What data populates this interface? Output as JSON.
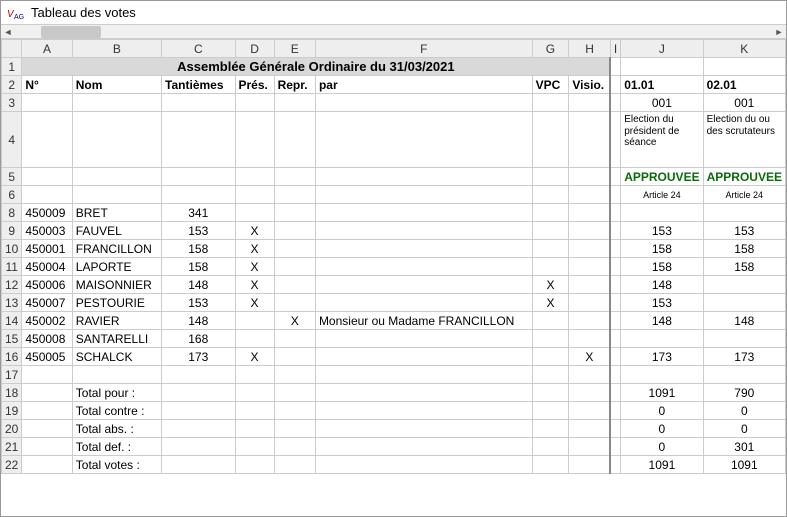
{
  "window": {
    "title": "Tableau des votes"
  },
  "columns": [
    "A",
    "B",
    "C",
    "D",
    "E",
    "F",
    "G",
    "H",
    "I",
    "J",
    "K"
  ],
  "rows_header": [
    "1",
    "2",
    "3",
    "4",
    "5",
    "6",
    "8",
    "9",
    "10",
    "11",
    "12",
    "13",
    "14",
    "15",
    "16",
    "17",
    "18",
    "19",
    "20",
    "21",
    "22"
  ],
  "title_row": "Assemblée Générale Ordinaire du 31/03/2021",
  "headers": {
    "A": "N°",
    "B": "Nom",
    "C": "Tantièmes",
    "D": "Prés.",
    "E": "Repr.",
    "F": "par",
    "G": "VPC",
    "H": "Visio.",
    "J": "01.01",
    "K": "02.01"
  },
  "row3": {
    "J": "001",
    "K": "001"
  },
  "row4": {
    "J": "Election du président de séance",
    "K": "Election du ou des scrutateurs"
  },
  "row5": {
    "J": "APPROUVEE",
    "K": "APPROUVEE"
  },
  "row6": {
    "J": "Article 24",
    "K": "Article 24"
  },
  "people": [
    {
      "rh": "8",
      "n": "450009",
      "nom": "BRET",
      "tan": "341",
      "pres": "",
      "repr": "",
      "par": "",
      "vpc": "",
      "vis": "",
      "j": "",
      "k": "",
      "jc": "",
      "kc": ""
    },
    {
      "rh": "9",
      "n": "450003",
      "nom": "FAUVEL",
      "tan": "153",
      "pres": "X",
      "repr": "",
      "par": "",
      "vpc": "",
      "vis": "",
      "j": "153",
      "k": "153",
      "jc": "green",
      "kc": "green"
    },
    {
      "rh": "10",
      "n": "450001",
      "nom": "FRANCILLON",
      "tan": "158",
      "pres": "X",
      "repr": "",
      "par": "",
      "vpc": "",
      "vis": "",
      "j": "158",
      "k": "158",
      "jc": "green",
      "kc": "green"
    },
    {
      "rh": "11",
      "n": "450004",
      "nom": "LAPORTE",
      "tan": "158",
      "pres": "X",
      "repr": "",
      "par": "",
      "vpc": "",
      "vis": "",
      "j": "158",
      "k": "158",
      "jc": "green",
      "kc": "green"
    },
    {
      "rh": "12",
      "n": "450006",
      "nom": "MAISONNIER",
      "tan": "148",
      "pres": "X",
      "repr": "",
      "par": "",
      "vpc": "X",
      "vis": "",
      "j": "148",
      "k": "",
      "jc": "green",
      "kc": "grey"
    },
    {
      "rh": "13",
      "n": "450007",
      "nom": "PESTOURIE",
      "tan": "153",
      "pres": "X",
      "repr": "",
      "par": "",
      "vpc": "X",
      "vis": "",
      "j": "153",
      "k": "",
      "jc": "green",
      "kc": ""
    },
    {
      "rh": "14",
      "n": "450002",
      "nom": "RAVIER",
      "tan": "148",
      "pres": "",
      "repr": "X",
      "par": "Monsieur ou Madame FRANCILLON",
      "vpc": "",
      "vis": "",
      "j": "148",
      "k": "148",
      "jc": "green",
      "kc": "green"
    },
    {
      "rh": "15",
      "n": "450008",
      "nom": "SANTARELLI",
      "tan": "168",
      "pres": "",
      "repr": "",
      "par": "",
      "vpc": "",
      "vis": "",
      "j": "",
      "k": "",
      "jc": "",
      "kc": ""
    },
    {
      "rh": "16",
      "n": "450005",
      "nom": "SCHALCK",
      "tan": "173",
      "pres": "X",
      "repr": "",
      "par": "",
      "vpc": "",
      "vis": "X",
      "j": "173",
      "k": "173",
      "jc": "green",
      "kc": "green"
    }
  ],
  "blank_row": "17",
  "totals": [
    {
      "rh": "18",
      "label": "Total pour :",
      "j": "1091",
      "k": "790"
    },
    {
      "rh": "19",
      "label": "Total contre :",
      "j": "0",
      "k": "0"
    },
    {
      "rh": "20",
      "label": "Total abs. :",
      "j": "0",
      "k": "0"
    },
    {
      "rh": "21",
      "label": "Total def. :",
      "j": "0",
      "k": "301"
    },
    {
      "rh": "22",
      "label": "Total votes :",
      "j": "1091",
      "k": "1091"
    }
  ]
}
